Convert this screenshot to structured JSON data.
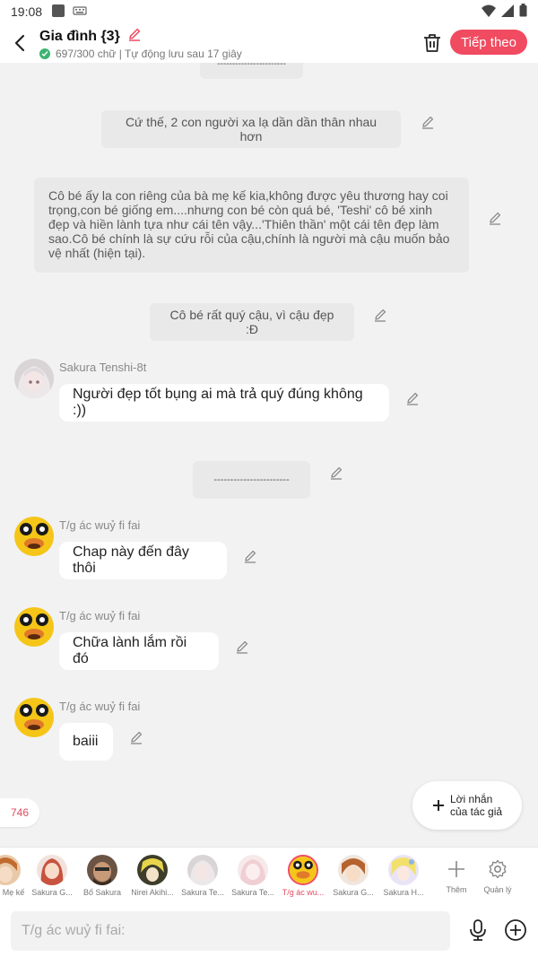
{
  "status_bar": {
    "time": "19:08"
  },
  "header": {
    "title": "Gia đình {3}",
    "subtitle": "697/300 chữ | Tự động lưu sau 17 giây",
    "next_label": "Tiếp theo"
  },
  "chat": {
    "narration": [
      {
        "text": "-----------------------"
      },
      {
        "text": "Cứ thế, 2 con người xa lạ dần dần thân nhau hơn"
      },
      {
        "text": "Cô bé ấy la con riêng của bà mẹ kế kia,không được yêu thương hay coi trọng,con bé giống em....nhưng con bé còn quá bé, 'Teshi' cô bé xinh đẹp và hiền lành tựa như cái tên vậy...'Thiên thần' một cái tên đẹp làm sao.Cô bé chính là sự cứu rỗi của cậu,chính là người mà cậu muốn bảo vệ nhất (hiện tại)."
      },
      {
        "text": "Cô bé rất quý cậu, vì cậu đẹp :Đ"
      },
      {
        "text": "-----------------------"
      }
    ],
    "messages": [
      {
        "sender": "Sakura Tenshi-8t",
        "text": "Người đẹp tốt bụng ai mà trả quý đúng không :))"
      },
      {
        "sender": "T/g ác wuỷ fi fai",
        "text": "Chap này đến đây thôi"
      },
      {
        "sender": "T/g ác wuỷ fi fai",
        "text": "Chữa lành lắm rồi đó"
      },
      {
        "sender": "T/g ác wuỷ fi fai",
        "text": "baiii"
      }
    ],
    "word_count": "746",
    "author_note_line1": "Lời nhắn",
    "author_note_line2": "của tác giả"
  },
  "characters": [
    {
      "name": "Mẹ kế",
      "active": false
    },
    {
      "name": "Sakura G...",
      "active": false
    },
    {
      "name": "Bố Sakura",
      "active": false
    },
    {
      "name": "Nirei Akihi...",
      "active": false
    },
    {
      "name": "Sakura Te...",
      "active": false
    },
    {
      "name": "Sakura Te...",
      "active": false
    },
    {
      "name": "T/g ác wu...",
      "active": true
    },
    {
      "name": "Sakura G...",
      "active": false
    },
    {
      "name": "Sakura H...",
      "active": false
    }
  ],
  "tools": {
    "more_label": "Thêm",
    "manage_label": "Quản lý"
  },
  "input": {
    "placeholder": "T/g ác wuỷ fi fai:"
  },
  "colors": {
    "accent": "#f04b61",
    "duck_yellow": "#f5c518",
    "bubble_gray": "#e9e9e9"
  },
  "icons": [
    "back-icon",
    "edit-pencil-icon",
    "check-icon",
    "trash-icon",
    "mic-icon",
    "plus-circle-icon",
    "gear-icon",
    "plus-icon"
  ]
}
